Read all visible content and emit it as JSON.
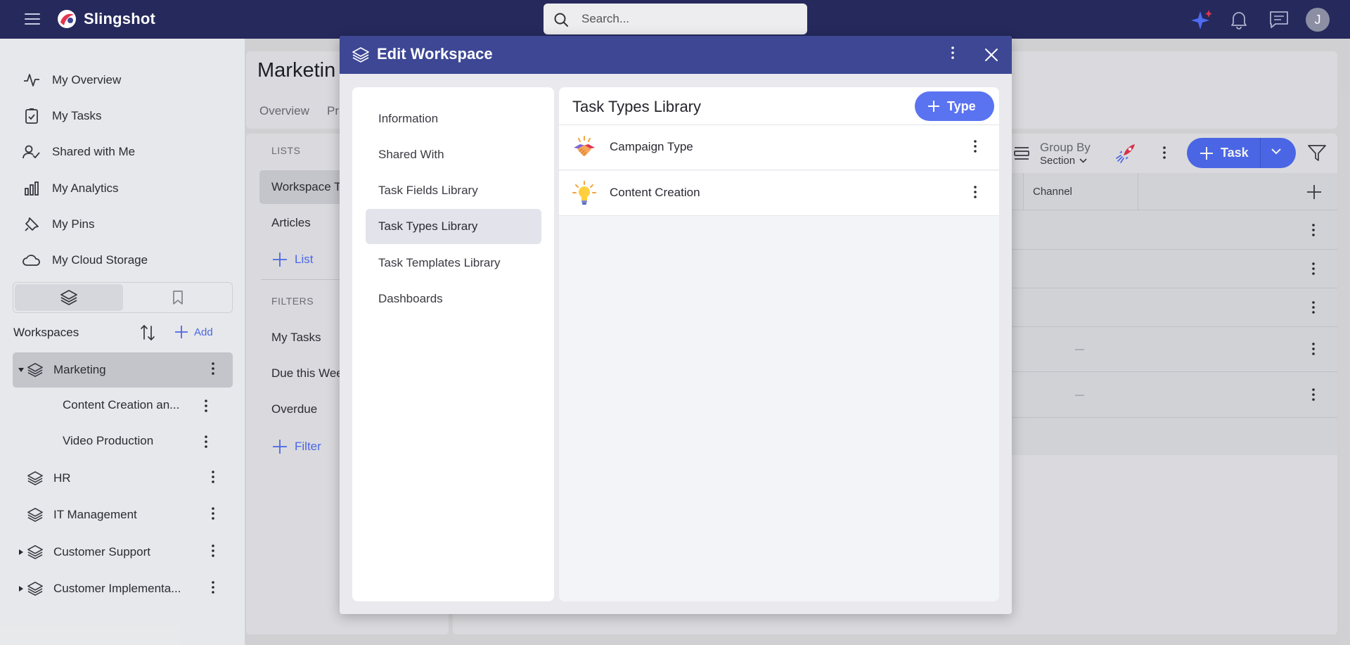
{
  "app": {
    "brand": "Slingshot"
  },
  "search": {
    "placeholder": "Search..."
  },
  "user": {
    "initial": "J"
  },
  "colors": {
    "topbar": "#25295c",
    "accent": "#4f6cf1",
    "modal_header": "#3d4794"
  },
  "sidebar": {
    "nav": [
      {
        "label": "My Overview",
        "icon": "activity-icon"
      },
      {
        "label": "My Tasks",
        "icon": "task-check-icon"
      },
      {
        "label": "Shared with Me",
        "icon": "user-check-icon"
      },
      {
        "label": "My Analytics",
        "icon": "bar-chart-icon"
      },
      {
        "label": "My Pins",
        "icon": "pin-icon"
      },
      {
        "label": "My Cloud Storage",
        "icon": "cloud-icon"
      }
    ],
    "workspaces_title": "Workspaces",
    "add_label": "Add",
    "workspaces": [
      {
        "label": "Marketing",
        "children": [
          "Content Creation an...",
          "Video Production"
        ]
      },
      {
        "label": "HR"
      },
      {
        "label": "IT Management"
      },
      {
        "label": "Customer Support"
      },
      {
        "label": "Customer Implementa..."
      }
    ]
  },
  "background": {
    "page_title": "Marketin",
    "tabs": [
      "Overview",
      "Pr"
    ],
    "lists_label": "LISTS",
    "lists": [
      "Workspace T",
      "Articles"
    ],
    "add_list": "List",
    "filters_label": "FILTERS",
    "filters": [
      "My Tasks",
      "Due this Wee",
      "Overdue"
    ],
    "add_filter": "Filter",
    "group_by": "Group By",
    "group_by_value": "Section",
    "task_button": "Task",
    "column_channel": "Channel"
  },
  "modal": {
    "title": "Edit Workspace",
    "nav": [
      "Information",
      "Shared With",
      "Task Fields Library",
      "Task Types Library",
      "Task Templates Library",
      "Dashboards"
    ],
    "selected_nav": "Task Types Library",
    "content_title": "Task Types Library",
    "add_type_label": "Type",
    "types": [
      {
        "name": "Campaign Type",
        "icon": "handshake-icon"
      },
      {
        "name": "Content Creation",
        "icon": "lightbulb-icon"
      }
    ]
  }
}
